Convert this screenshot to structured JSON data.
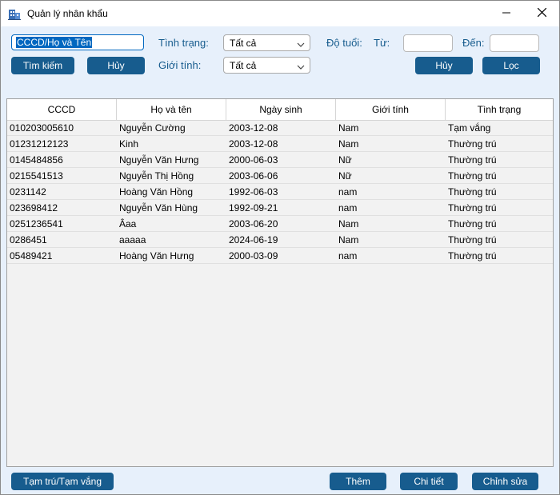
{
  "window": {
    "title": "Quản lý nhân khẩu",
    "minimize_glyph": "—",
    "close_glyph": "✕"
  },
  "search": {
    "value": "CCCD/Họ và Tên",
    "search_button": "Tìm kiếm",
    "cancel_button": "Hủy"
  },
  "filters": {
    "status_label": "Tình trạng:",
    "status_value": "Tất cả",
    "gender_label": "Giới tính:",
    "gender_value": "Tất cả",
    "age_label": "Độ tuổi:",
    "from_label": "Từ:",
    "to_label": "Đến:",
    "from_value": "",
    "to_value": "",
    "cancel_button": "Hủy",
    "filter_button": "Lọc"
  },
  "table": {
    "columns": [
      "CCCD",
      "Họ và tên",
      "Ngày sinh",
      "Giới tính",
      "Tình trạng"
    ],
    "rows": [
      [
        "010203005610",
        "Nguyễn Cường",
        "2003-12-08",
        "Nam",
        "Tạm vắng"
      ],
      [
        "01231212123",
        "Kinh",
        "2003-12-08",
        "Nam",
        "Thường trú"
      ],
      [
        "0145484856",
        "Nguyễn Văn Hưng",
        "2000-06-03",
        "Nữ",
        "Thường trú"
      ],
      [
        "0215541513",
        "Nguyễn Thị Hồng",
        "2003-06-06",
        "Nữ",
        "Thường trú"
      ],
      [
        "0231142",
        "Hoàng Văn Hồng",
        "1992-06-03",
        "nam",
        "Thường trú"
      ],
      [
        "023698412",
        "Nguyễn Văn Hùng",
        "1992-09-21",
        "nam",
        "Thường trú"
      ],
      [
        "0251236541",
        "Âaa",
        "2003-06-20",
        "Nam",
        "Thường trú"
      ],
      [
        "0286451",
        "aaaaa",
        "2024-06-19",
        "Nam",
        "Thường trú"
      ],
      [
        "05489421",
        "Hoàng Văn Hưng",
        "2000-03-09",
        "nam",
        "Thường trú"
      ]
    ]
  },
  "footer": {
    "temp_button": "Tạm trú/Tạm vắng",
    "add_button": "Thêm",
    "detail_button": "Chi tiết",
    "edit_button": "Chỉnh sửa"
  },
  "colors": {
    "accent": "#175c8e",
    "background": "#e7f0fb",
    "selection": "#0067c0"
  },
  "icons": {
    "app": "building-icon",
    "minimize": "minimize-icon",
    "close": "close-icon",
    "dropdown": "chevron-down-icon"
  }
}
